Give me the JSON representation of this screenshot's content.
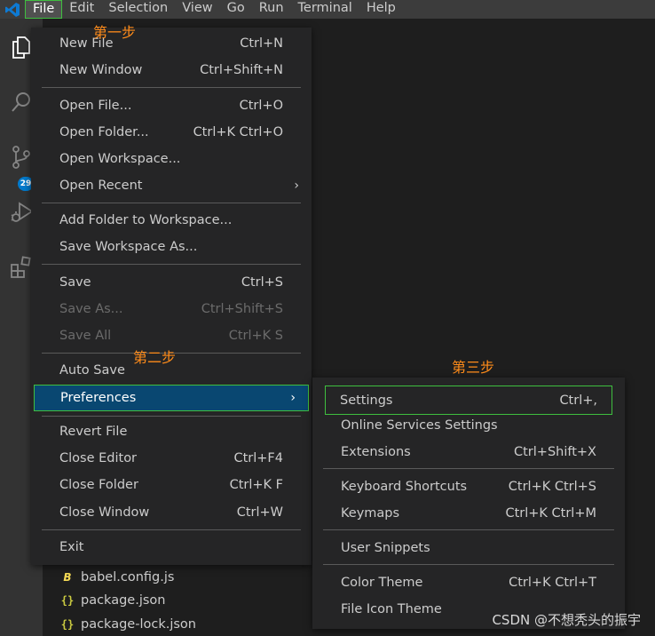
{
  "menubar": {
    "items": [
      "File",
      "Edit",
      "Selection",
      "View",
      "Go",
      "Run",
      "Terminal",
      "Help"
    ],
    "active": "File"
  },
  "activity_bar": {
    "icons": [
      "explorer-icon",
      "search-icon",
      "source-control-icon",
      "run-debug-icon",
      "extensions-icon"
    ],
    "scm_badge": "29"
  },
  "explorer": {
    "files": [
      {
        "name": "babel.config.js",
        "icon": "babel-file-icon"
      },
      {
        "name": "package.json",
        "icon": "json-file-icon"
      },
      {
        "name": "package-lock.json",
        "icon": "json-file-icon"
      }
    ]
  },
  "file_menu": {
    "groups": [
      [
        {
          "label": "New File",
          "shortcut": "Ctrl+N"
        },
        {
          "label": "New Window",
          "shortcut": "Ctrl+Shift+N"
        }
      ],
      [
        {
          "label": "Open File...",
          "shortcut": "Ctrl+O"
        },
        {
          "label": "Open Folder...",
          "shortcut": "Ctrl+K Ctrl+O"
        },
        {
          "label": "Open Workspace...",
          "shortcut": ""
        },
        {
          "label": "Open Recent",
          "shortcut": "",
          "submenu": true
        }
      ],
      [
        {
          "label": "Add Folder to Workspace...",
          "shortcut": ""
        },
        {
          "label": "Save Workspace As...",
          "shortcut": ""
        }
      ],
      [
        {
          "label": "Save",
          "shortcut": "Ctrl+S"
        },
        {
          "label": "Save As...",
          "shortcut": "Ctrl+Shift+S",
          "disabled": true
        },
        {
          "label": "Save All",
          "shortcut": "Ctrl+K S",
          "disabled": true
        }
      ],
      [
        {
          "label": "Auto Save",
          "shortcut": ""
        },
        {
          "label": "Preferences",
          "shortcut": "",
          "submenu": true,
          "selected": true
        }
      ],
      [
        {
          "label": "Revert File",
          "shortcut": ""
        },
        {
          "label": "Close Editor",
          "shortcut": "Ctrl+F4"
        },
        {
          "label": "Close Folder",
          "shortcut": "Ctrl+K F"
        },
        {
          "label": "Close Window",
          "shortcut": "Ctrl+W"
        }
      ],
      [
        {
          "label": "Exit",
          "shortcut": ""
        }
      ]
    ]
  },
  "preferences_menu": {
    "groups": [
      [
        {
          "label": "Settings",
          "shortcut": "Ctrl+,",
          "boxed": true
        },
        {
          "label": "Online Services Settings",
          "shortcut": ""
        },
        {
          "label": "Extensions",
          "shortcut": "Ctrl+Shift+X"
        }
      ],
      [
        {
          "label": "Keyboard Shortcuts",
          "shortcut": "Ctrl+K Ctrl+S"
        },
        {
          "label": "Keymaps",
          "shortcut": "Ctrl+K Ctrl+M"
        }
      ],
      [
        {
          "label": "User Snippets",
          "shortcut": ""
        }
      ],
      [
        {
          "label": "Color Theme",
          "shortcut": "Ctrl+K Ctrl+T"
        },
        {
          "label": "File Icon Theme",
          "shortcut": ""
        }
      ]
    ]
  },
  "annotations": {
    "step1": "第一步",
    "step2": "第二步",
    "step3": "第三步"
  },
  "watermark": "CSDN @不想秃头的振宇",
  "colors": {
    "menu_bg": "#252526",
    "selected_bg": "#094771",
    "highlight_border": "#3fbf3f",
    "annotation": "#ff8c1a",
    "badge": "#007acc"
  }
}
